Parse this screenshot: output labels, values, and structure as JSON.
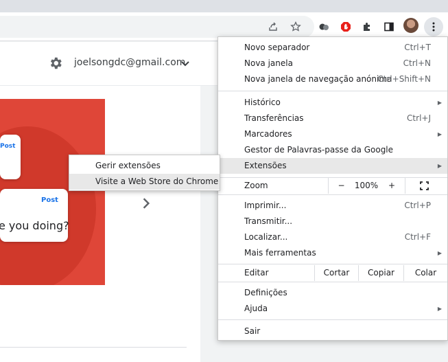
{
  "account": {
    "email": "joelsongdc@gmail.com"
  },
  "page": {
    "post_label_1": "Post",
    "post_label_2": "Post",
    "post_text": "e you doing?"
  },
  "menu": {
    "group1": [
      {
        "label": "Novo separador",
        "shortcut": "Ctrl+T"
      },
      {
        "label": "Nova janela",
        "shortcut": "Ctrl+N"
      },
      {
        "label": "Nova janela de navegação anónima",
        "shortcut": "Ctrl+Shift+N"
      }
    ],
    "group2": [
      {
        "label": "Histórico",
        "shortcut": ""
      },
      {
        "label": "Transferências",
        "shortcut": "Ctrl+J"
      },
      {
        "label": "Marcadores",
        "shortcut": ""
      },
      {
        "label": "Gestor de Palavras-passe da Google",
        "shortcut": ""
      },
      {
        "label": "Extensões",
        "shortcut": ""
      }
    ],
    "zoom": {
      "label": "Zoom",
      "minus": "−",
      "value": "100%",
      "plus": "+"
    },
    "group3": [
      {
        "label": "Imprimir...",
        "shortcut": "Ctrl+P"
      },
      {
        "label": "Transmitir...",
        "shortcut": ""
      },
      {
        "label": "Localizar...",
        "shortcut": "Ctrl+F"
      },
      {
        "label": "Mais ferramentas",
        "shortcut": ""
      }
    ],
    "edit": {
      "label": "Editar",
      "cut": "Cortar",
      "copy": "Copiar",
      "paste": "Colar"
    },
    "group4": [
      {
        "label": "Definições"
      },
      {
        "label": "Ajuda"
      }
    ],
    "exit": "Sair"
  },
  "submenu": {
    "items": [
      {
        "label": "Gerir extensões"
      },
      {
        "label": "Visite a Web Store do Chrome"
      }
    ]
  },
  "colors": {
    "accent": "#1a73e8",
    "hero": "#df4638",
    "adblock": "#e8201a"
  }
}
